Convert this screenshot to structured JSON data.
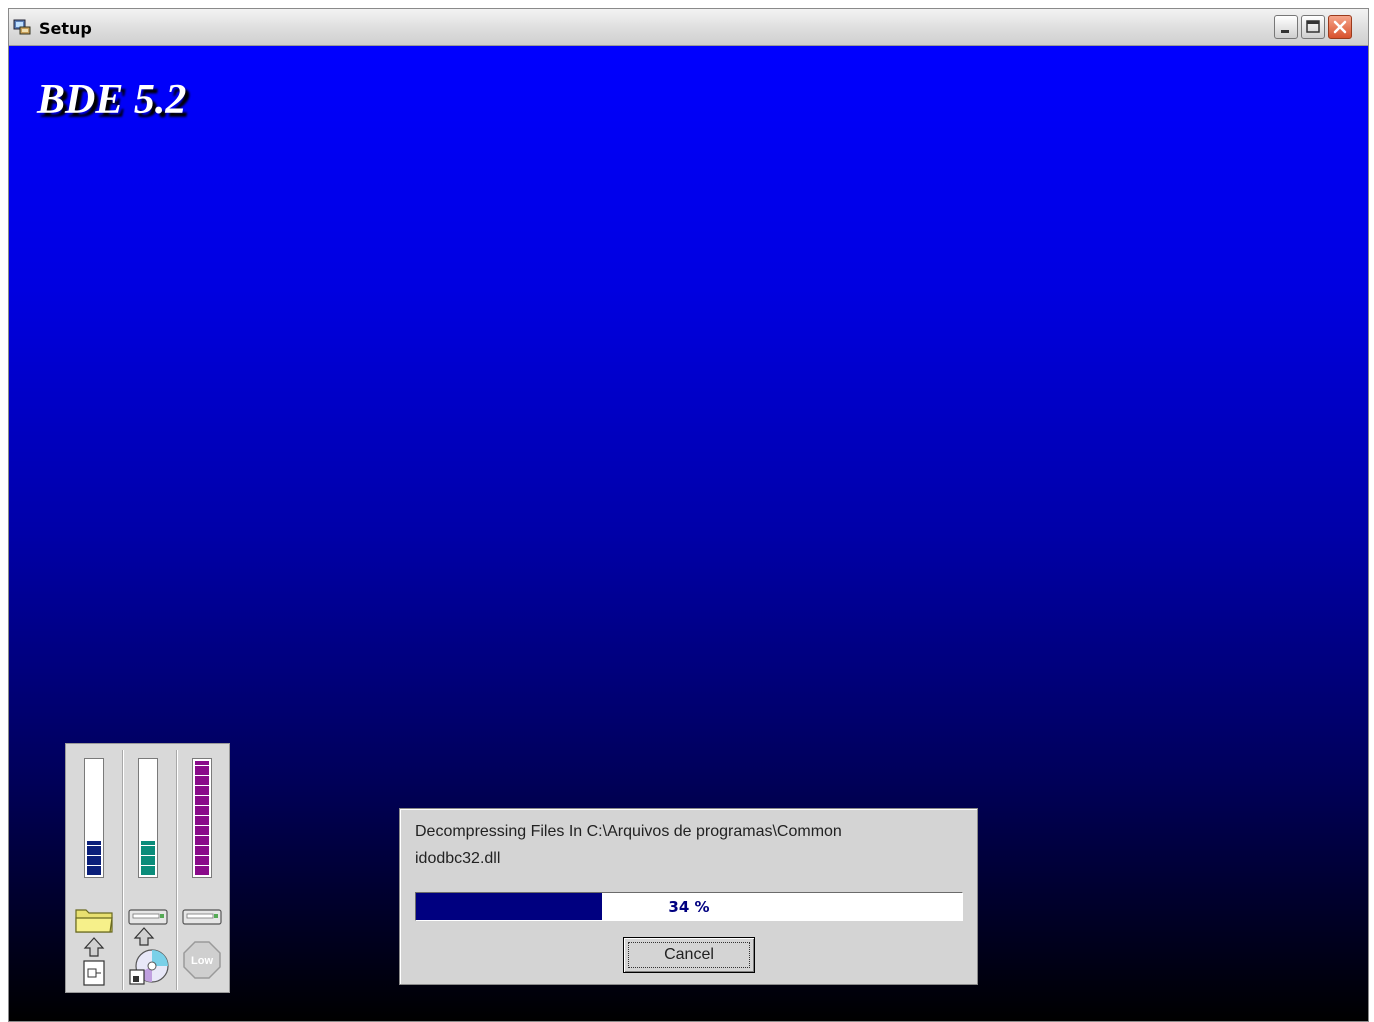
{
  "window": {
    "title": "Setup",
    "controls": {
      "minimize": "minimize-icon",
      "maximize": "maximize-icon",
      "close": "close-icon"
    }
  },
  "background": {
    "gradient_top": "#0000ff",
    "gradient_bottom": "#000000"
  },
  "product": {
    "title": "BDE 5.2"
  },
  "meters": [
    {
      "name": "destination-disk",
      "level": 0.3,
      "color": "#0a1f7a",
      "icon": "folder-icon"
    },
    {
      "name": "source-cd",
      "level": 0.3,
      "color": "#0a8c7a",
      "icon": "cd-icon"
    },
    {
      "name": "disk-space",
      "level": 1.0,
      "color": "#8a0a8a",
      "icon": "low-space-icon",
      "icon_text": "Low"
    }
  ],
  "dialog": {
    "line1": "Decompressing Files In C:\\Arquivos de programas\\Common",
    "line2": "idodbc32.dll",
    "progress_percent": 34,
    "progress_text": "34 %",
    "progress_color": "#000080",
    "cancel_label": "Cancel"
  }
}
